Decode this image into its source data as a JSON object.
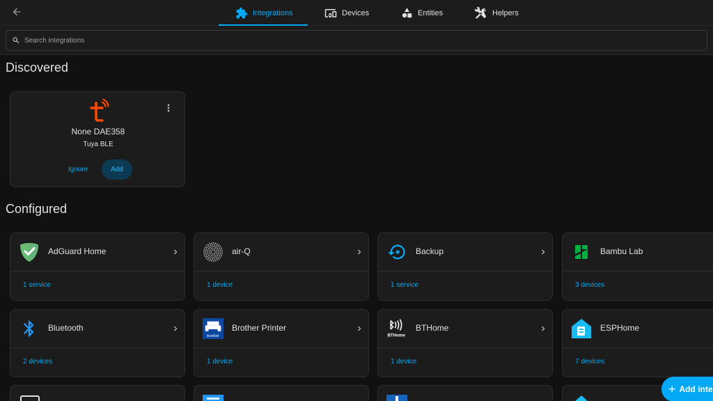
{
  "header": {
    "tabs": [
      {
        "label": "Integrations",
        "icon": "puzzle-icon",
        "active": true
      },
      {
        "label": "Devices",
        "icon": "devices-icon",
        "active": false
      },
      {
        "label": "Entities",
        "icon": "shapes-icon",
        "active": false
      },
      {
        "label": "Helpers",
        "icon": "tools-icon",
        "active": false
      }
    ]
  },
  "search": {
    "placeholder": "Search integrations"
  },
  "discovered": {
    "title": "Discovered",
    "card": {
      "name": "None DAE358",
      "integration": "Tuya BLE",
      "logo": "tuya-logo",
      "ignore_label": "Ignore",
      "add_label": "Add"
    }
  },
  "configured": {
    "title": "Configured",
    "cards": [
      {
        "name": "AdGuard Home",
        "count": "1 service",
        "icon": "adguard-icon"
      },
      {
        "name": "air-Q",
        "count": "1 device",
        "icon": "airq-icon"
      },
      {
        "name": "Backup",
        "count": "1 service",
        "icon": "backup-icon"
      },
      {
        "name": "Bambu Lab",
        "count": "3 devices",
        "icon": "bambulab-icon"
      },
      {
        "name": "Bluetooth",
        "count": "2 devices",
        "icon": "bluetooth-icon"
      },
      {
        "name": "Brother Printer",
        "count": "1 device",
        "icon": "brother-icon"
      },
      {
        "name": "BTHome",
        "count": "1 device",
        "icon": "bthome-icon"
      },
      {
        "name": "ESPHome",
        "count": "7 devices",
        "icon": "esphome-icon"
      }
    ]
  },
  "fab": {
    "label": "Add inte"
  },
  "colors": {
    "accent": "#03a9f4",
    "background": "#111111",
    "card": "#1c1c1c",
    "tuya": "#ff4800",
    "adguard": "#68bc71",
    "bambu": "#00ae42",
    "esphome": "#18bcf2",
    "brother": "#0d47a1"
  }
}
